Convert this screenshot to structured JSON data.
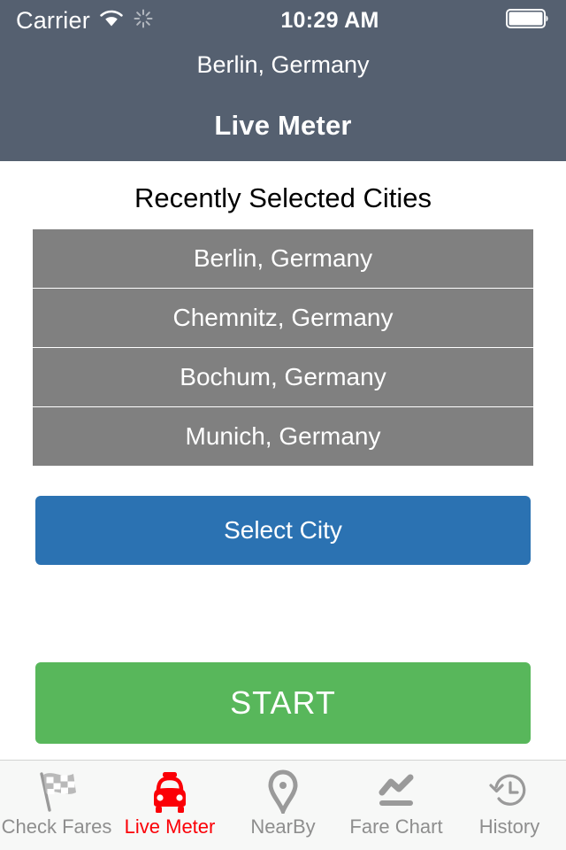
{
  "statusbar": {
    "carrier": "Carrier",
    "time": "10:29 AM",
    "wifi_icon": "wifi-icon",
    "activity_icon": "activity-spinner-icon",
    "battery_icon": "battery-full-icon"
  },
  "header": {
    "subtitle": "Berlin, Germany",
    "title": "Live Meter",
    "background_color": "#556070"
  },
  "main": {
    "section_title": "Recently Selected Cities",
    "cities": [
      {
        "label": "Berlin, Germany"
      },
      {
        "label": "Chemnitz, Germany"
      },
      {
        "label": "Bochum, Germany"
      },
      {
        "label": "Munich, Germany"
      }
    ],
    "city_item_color": "#808080",
    "select_city_button": {
      "label": "Select City",
      "color": "#2b72b2"
    },
    "start_button": {
      "label": "START",
      "color": "#58b75b"
    }
  },
  "tabbar": {
    "active_color": "#fb0007",
    "inactive_color": "#8e8e8e",
    "tabs": [
      {
        "label": "Check Fares",
        "icon": "checkered-flag-icon",
        "active": false
      },
      {
        "label": "Live Meter",
        "icon": "taxi-car-icon",
        "active": true
      },
      {
        "label": "NearBy",
        "icon": "map-pin-icon",
        "active": false
      },
      {
        "label": "Fare Chart",
        "icon": "line-chart-icon",
        "active": false
      },
      {
        "label": "History",
        "icon": "clock-history-icon",
        "active": false
      }
    ]
  }
}
